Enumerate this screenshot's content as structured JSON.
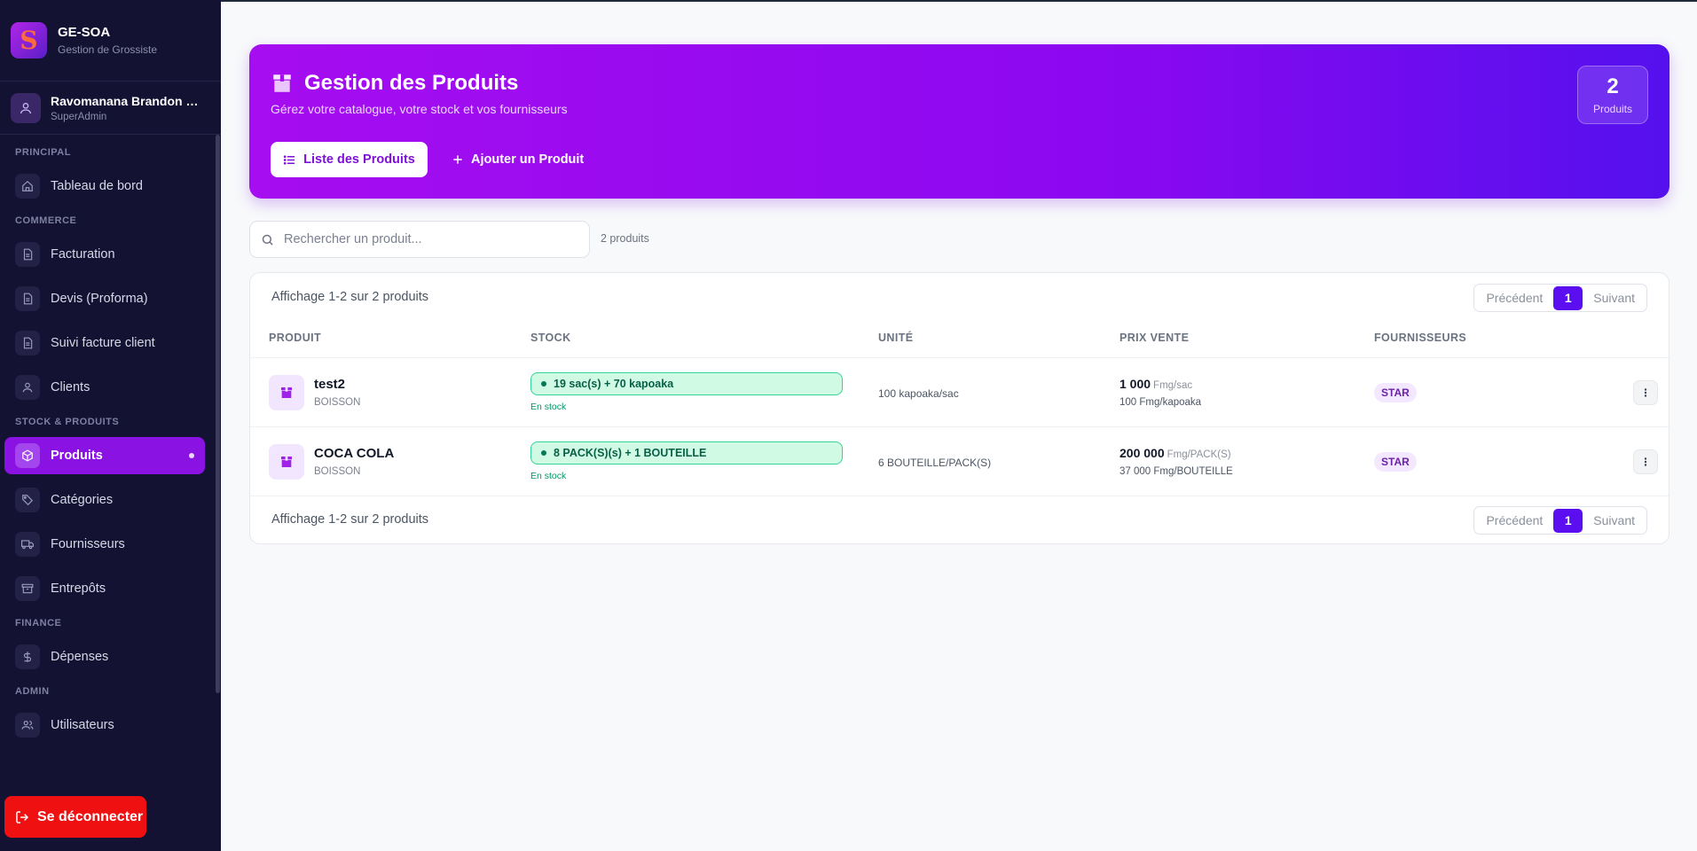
{
  "app": {
    "name": "GE-SOA",
    "subtitle": "Gestion de Grossiste",
    "logo_letter": "S"
  },
  "user": {
    "name": "Ravomanana Brandon Fi...",
    "role": "SuperAdmin"
  },
  "sidebar": {
    "sections": [
      {
        "title": "PRINCIPAL",
        "items": [
          {
            "label": "Tableau de bord",
            "icon": "home-icon"
          }
        ]
      },
      {
        "title": "COMMERCE",
        "items": [
          {
            "label": "Facturation",
            "icon": "document-icon"
          },
          {
            "label": "Devis (Proforma)",
            "icon": "document-icon"
          },
          {
            "label": "Suivi facture client",
            "icon": "document-icon"
          },
          {
            "label": "Clients",
            "icon": "user-icon"
          }
        ]
      },
      {
        "title": "STOCK & PRODUITS",
        "items": [
          {
            "label": "Produits",
            "icon": "box-icon",
            "active": true
          },
          {
            "label": "Catégories",
            "icon": "tag-icon"
          },
          {
            "label": "Fournisseurs",
            "icon": "truck-icon"
          },
          {
            "label": "Entrepôts",
            "icon": "archive-icon"
          }
        ]
      },
      {
        "title": "FINANCE",
        "items": [
          {
            "label": "Dépenses",
            "icon": "dollar-icon"
          }
        ]
      },
      {
        "title": "ADMIN",
        "items": [
          {
            "label": "Utilisateurs",
            "icon": "users-icon"
          }
        ]
      }
    ],
    "logout_label": "Se déconnecter"
  },
  "hero": {
    "title": "Gestion des Produits",
    "subtitle": "Gérez votre catalogue, votre stock et vos fournisseurs",
    "list_button": "Liste des Produits",
    "add_button": "Ajouter un Produit",
    "counter_value": "2",
    "counter_label": "Produits"
  },
  "search": {
    "placeholder": "Rechercher un produit...",
    "count": "2 produits"
  },
  "table": {
    "summary_top": "Affichage 1-2 sur 2 produits",
    "summary_bottom": "Affichage 1-2 sur 2 produits",
    "pagination": {
      "prev": "Précédent",
      "page": "1",
      "next": "Suivant"
    },
    "columns": [
      "PRODUIT",
      "STOCK",
      "UNITÉ",
      "PRIX VENTE",
      "FOURNISSEURS"
    ],
    "rows": [
      {
        "name": "test2",
        "category": "BOISSON",
        "stock": "19 sac(s) + 70 kapoaka",
        "stock_status": "En stock",
        "unit": "100 kapoaka/sac",
        "price": "1 000",
        "price_unit": "Fmg/sac",
        "price_sub": "100 Fmg/kapoaka",
        "supplier": "STAR"
      },
      {
        "name": "COCA COLA",
        "category": "BOISSON",
        "stock": "8 PACK(S)(s) + 1 BOUTEILLE",
        "stock_status": "En stock",
        "unit": "6 BOUTEILLE/PACK(S)",
        "price": "200 000",
        "price_unit": "Fmg/PACK(S)",
        "price_sub": "37 000 Fmg/BOUTEILLE",
        "supplier": "STAR"
      }
    ]
  },
  "colors": {
    "sidebar_bg": "#141233",
    "accent": "#8a12e2",
    "hero_start": "#a60df0",
    "hero_end": "#5510ee",
    "danger": "#ef1111",
    "stock_ok": "#d1fae5"
  }
}
